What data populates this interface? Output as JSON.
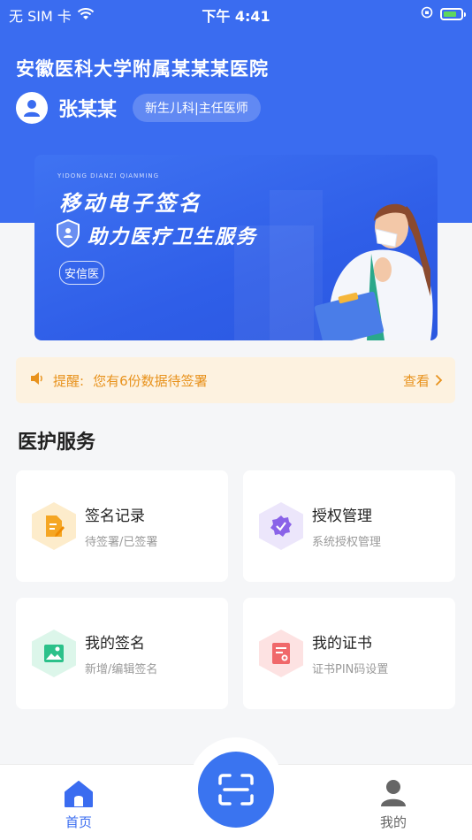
{
  "status_bar": {
    "carrier": "无 SIM 卡",
    "time": "下午 4:41"
  },
  "header": {
    "hospital_name": "安徽医科大学附属某某某医院",
    "user_name": "张某某",
    "department": "新生儿科|主任医师"
  },
  "banner": {
    "pinyin": "YIDONG DIANZI QIANMING",
    "title": "移动电子签名",
    "subtitle": "助力医疗卫生服务",
    "badge": "安信医"
  },
  "notice": {
    "label": "提醒:",
    "message": "您有6份数据待签署",
    "action": "查看",
    "color": "#e8921c"
  },
  "services": {
    "title": "医护服务",
    "items": [
      {
        "title": "签名记录",
        "subtitle": "待签署/已签署",
        "icon": "document-sign-icon",
        "color": "#f5a623"
      },
      {
        "title": "授权管理",
        "subtitle": "系统授权管理",
        "icon": "authorize-badge-icon",
        "color": "#8a63e8"
      },
      {
        "title": "我的签名",
        "subtitle": "新增/编辑签名",
        "icon": "signature-image-icon",
        "color": "#2cc18a"
      },
      {
        "title": "我的证书",
        "subtitle": "证书PIN码设置",
        "icon": "certificate-icon",
        "color": "#f0686a"
      }
    ]
  },
  "tabbar": {
    "home": "首页",
    "mine": "我的",
    "active_color": "#3a6cf0",
    "inactive_color": "#666666"
  }
}
